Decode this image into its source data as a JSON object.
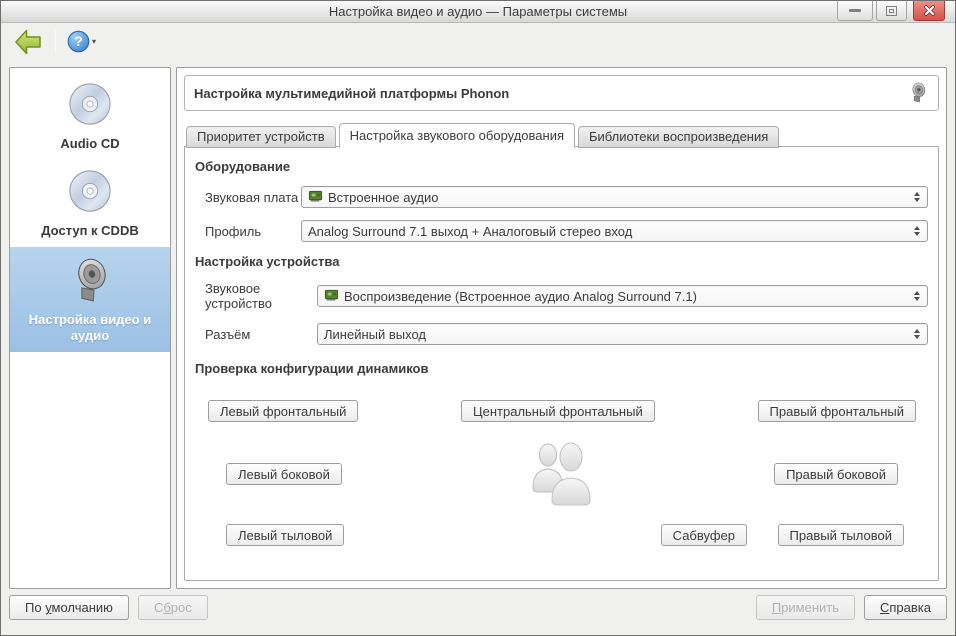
{
  "window": {
    "title": "Настройка видео и аудио — Параметры системы"
  },
  "toolbar": {
    "help_glyph": "?",
    "help_caret": "▾"
  },
  "sidebar": {
    "items": [
      {
        "label": "Audio CD"
      },
      {
        "label": "Доступ к CDDB"
      },
      {
        "label": "Настройка видео и аудио"
      }
    ]
  },
  "main": {
    "header_title": "Настройка мультимедийной платформы Phonon",
    "tabs": [
      {
        "label": "Приоритет устройств"
      },
      {
        "label": "Настройка звукового оборудования"
      },
      {
        "label": "Библиотеки воспроизведения"
      }
    ],
    "hardware": {
      "title": "Оборудование",
      "sound_card_label": "Звуковая плата",
      "sound_card_value": "Встроенное аудио",
      "profile_label": "Профиль",
      "profile_value": "Analog Surround 7.1 выход + Аналоговый стерео вход"
    },
    "device": {
      "title": "Настройка устройства",
      "device_label": "Звуковое устройство",
      "device_value": "Воспроизведение (Встроенное аудио Analog Surround 7.1)",
      "jack_label": "Разъём",
      "jack_value": "Линейный выход"
    },
    "speakers": {
      "title": "Проверка конфигурации динамиков",
      "front_left": "Левый фронтальный",
      "front_center": "Центральный фронтальный",
      "front_right": "Правый фронтальный",
      "side_left": "Левый боковой",
      "side_right": "Правый боковой",
      "rear_left": "Левый тыловой",
      "subwoofer": "Сабвуфер",
      "rear_right": "Правый тыловой"
    }
  },
  "footer": {
    "defaults": {
      "pre": "По ",
      "key": "у",
      "post": "молчанию"
    },
    "reset": {
      "pre": "С",
      "key": "б",
      "post": "рос"
    },
    "apply": {
      "pre": "",
      "key": "П",
      "post": "рименить"
    },
    "help": {
      "pre": "",
      "key": "С",
      "post": "правка"
    }
  },
  "colors": {
    "selection_blue": "#a6c8e8",
    "close_red": "#d9534f",
    "accent_green": "#9ab835",
    "help_blue": "#3d84d0"
  }
}
